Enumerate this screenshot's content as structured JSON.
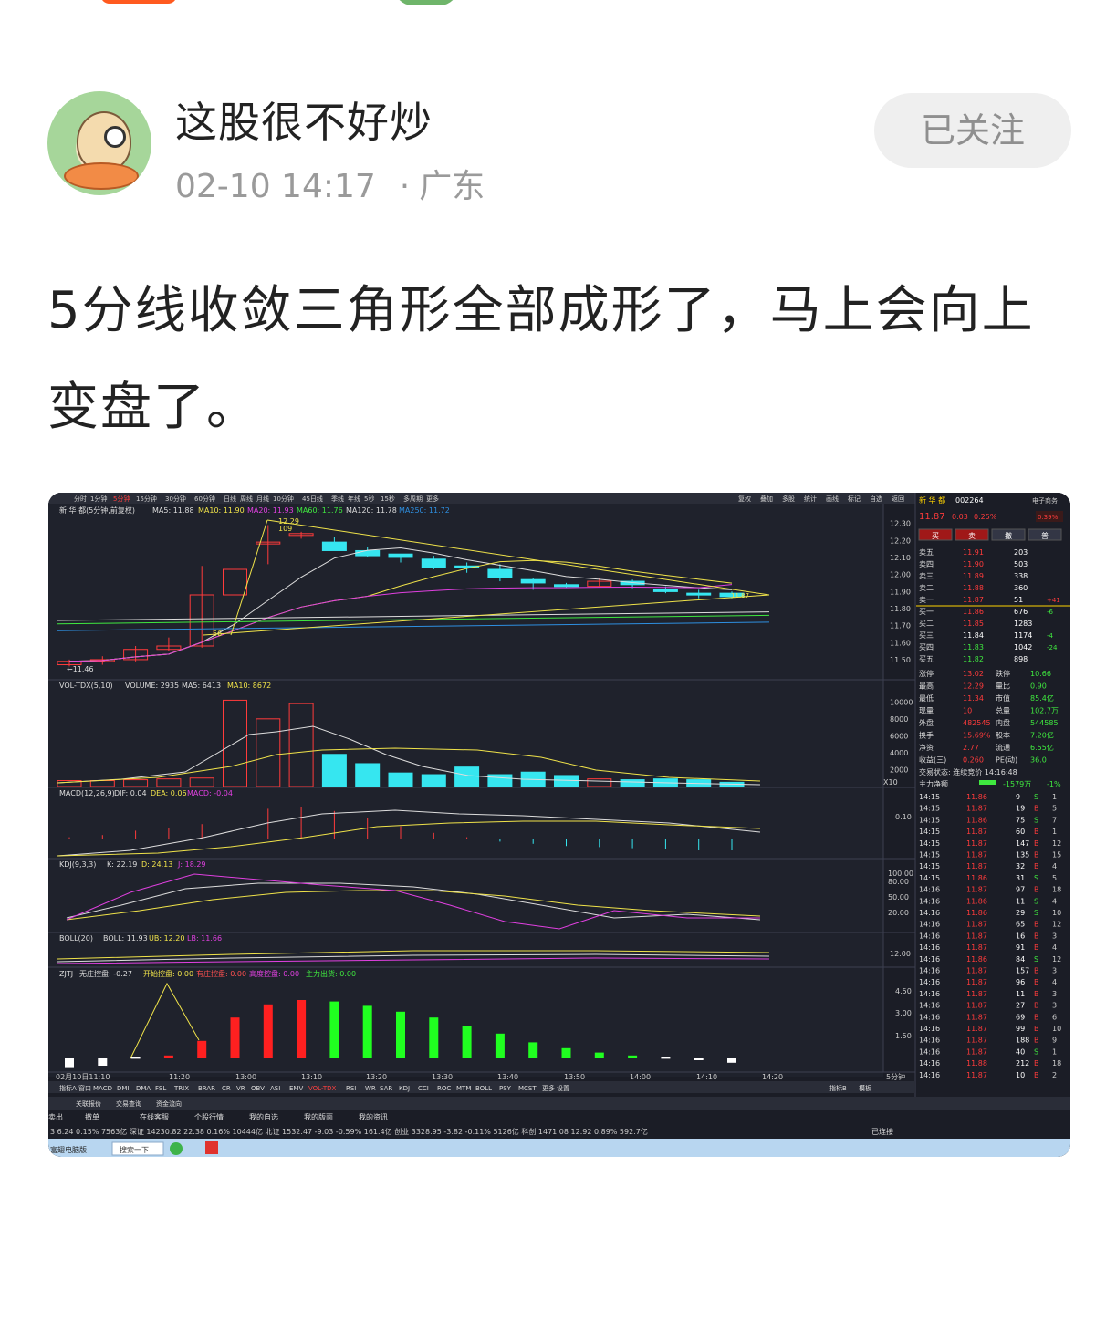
{
  "post": {
    "username": "这股很不好炒",
    "date": "02-10 14:17",
    "location": "广东",
    "follow_label": "已关注",
    "text": "5分线收敛三角形全部成形了，马上会向上变盘了。"
  },
  "screenshot": {
    "period_tabs": [
      "分时",
      "1分钟",
      "5分钟",
      "15分钟",
      "30分钟",
      "60分钟",
      "日线",
      "周线",
      "月线",
      "10分钟",
      "45日线",
      "季线",
      "年线",
      "5秒",
      "15秒",
      "多周期",
      "更多"
    ],
    "active_period": "5分钟",
    "right_tools": [
      "复权",
      "叠加",
      "多股",
      "统计",
      "画线",
      "标记",
      "自选",
      "返回"
    ],
    "header": {
      "name": "新 华 都(5分钟,前复权)",
      "ma5": "MA5: 11.88",
      "ma10": "MA10: 11.90",
      "ma20": "MA20: 11.93",
      "ma60": "MA60: 11.76",
      "ma120": "MA120: 11.78",
      "ma250": "MA250: 11.72"
    },
    "price_axis": [
      "12.30",
      "12.20",
      "12.10",
      "12.00",
      "11.90",
      "11.80",
      "11.70",
      "11.60",
      "11.50"
    ],
    "high_label": "12.29",
    "high_label2": "109",
    "low_label": "←11.46",
    "mark_56": "56",
    "last_label": "11.87",
    "vol": {
      "label": "VOL-TDX(5,10)",
      "volume": "VOLUME: 2935",
      "ma5": "MA5: 6413",
      "ma10": "MA10: 8672",
      "axis": [
        "10000",
        "8000",
        "6000",
        "4000",
        "2000"
      ],
      "unit": "X10"
    },
    "macd": {
      "label": "MACD(12,26,9)",
      "dif": "DIF: 0.04",
      "dea": "DEA: 0.06",
      "macd": "MACD: -0.04",
      "axis": [
        "0.10"
      ]
    },
    "kdj": {
      "label": "KDJ(9,3,3)",
      "k": "K: 22.19",
      "d": "D: 24.13",
      "j": "J: 18.29",
      "axis": [
        "100.00",
        "80.00",
        "50.00",
        "20.00"
      ]
    },
    "boll": {
      "label": "BOLL(20)",
      "boll": "BOLL: 11.93",
      "ub": "UB: 12.20",
      "lb": "LB: 11.66",
      "axis": [
        "12.00"
      ]
    },
    "zjtj": {
      "label": "ZJTJ",
      "wzk": "无庄控盘: -0.27",
      "kszk": "开始控盘: 0.00",
      "yzk": "有庄控盘: 0.00",
      "gdk": "高度控盘: 0.00",
      "zl": "主力出货: 0.00",
      "axis": [
        "4.50",
        "3.00",
        "1.50"
      ]
    },
    "time_axis": [
      "02月10日11:10",
      "11:20",
      "13:00",
      "13:10",
      "13:20",
      "13:30",
      "13:40",
      "13:50",
      "14:00",
      "14:10",
      "14:20"
    ],
    "time_axis_unit": "5分钟",
    "indicator_tabs": [
      "指标A",
      "窗口",
      "MACD",
      "DMI",
      "DMA",
      "FSL",
      "TRIX",
      "BRAR",
      "CR",
      "VR",
      "OBV",
      "ASI",
      "EMV",
      "VOL-TDX",
      "RSI",
      "WR",
      "SAR",
      "KDJ",
      "CCI",
      "ROC",
      "MTM",
      "BOLL",
      "PSY",
      "MCST",
      "更多",
      "设置"
    ],
    "indicator_right": [
      "指标B",
      "模板"
    ],
    "quote": {
      "name": "新 华 都",
      "code": "002264",
      "industry": "电子商务",
      "price": "11.87",
      "change": "0.03",
      "pct": "0.25%",
      "pct2": "0.39%",
      "buttons": [
        "买",
        "卖",
        "撤",
        "普"
      ],
      "asks": [
        {
          "label": "卖五",
          "price": "11.91",
          "vol": "203",
          "chg": ""
        },
        {
          "label": "卖四",
          "price": "11.90",
          "vol": "503",
          "chg": ""
        },
        {
          "label": "卖三",
          "price": "11.89",
          "vol": "338",
          "chg": ""
        },
        {
          "label": "卖二",
          "price": "11.88",
          "vol": "360",
          "chg": ""
        },
        {
          "label": "卖一",
          "price": "11.87",
          "vol": "51",
          "chg": "+41"
        }
      ],
      "bids": [
        {
          "label": "买一",
          "price": "11.86",
          "vol": "676",
          "chg": "-6"
        },
        {
          "label": "买二",
          "price": "11.85",
          "vol": "1283",
          "chg": ""
        },
        {
          "label": "买三",
          "price": "11.84",
          "vol": "1174",
          "chg": "-4"
        },
        {
          "label": "买四",
          "price": "11.83",
          "vol": "1042",
          "chg": "-24"
        },
        {
          "label": "买五",
          "price": "11.82",
          "vol": "898",
          "chg": ""
        }
      ],
      "stats": [
        [
          "涨停",
          "13.02",
          "跌停",
          "10.66"
        ],
        [
          "最高",
          "12.29",
          "量比",
          "0.90"
        ],
        [
          "最低",
          "11.34",
          "市值",
          "85.4亿"
        ],
        [
          "现量",
          "10",
          "总量",
          "102.7万"
        ],
        [
          "外盘",
          "482545",
          "内盘",
          "544585"
        ],
        [
          "换手",
          "15.69%",
          "股本",
          "7.20亿"
        ],
        [
          "净资",
          "2.77",
          "流通",
          "6.55亿"
        ],
        [
          "收益(三)",
          "0.260",
          "PE(动)",
          "36.0"
        ]
      ],
      "status": "交易状态: 连续竞价 14:16:48",
      "main_net_label": "主力净额",
      "main_net": "-1579万",
      "main_net_pct": "-1%",
      "ticks": [
        [
          "14:15",
          "11.86",
          "9",
          "S",
          "1"
        ],
        [
          "14:15",
          "11.87",
          "19",
          "B",
          "5"
        ],
        [
          "14:15",
          "11.86",
          "75",
          "S",
          "7"
        ],
        [
          "14:15",
          "11.87",
          "60",
          "B",
          "1"
        ],
        [
          "14:15",
          "11.87",
          "147",
          "B",
          "12"
        ],
        [
          "14:15",
          "11.87",
          "135",
          "B",
          "15"
        ],
        [
          "14:15",
          "11.87",
          "32",
          "B",
          "4"
        ],
        [
          "14:15",
          "11.86",
          "31",
          "S",
          "5"
        ],
        [
          "14:16",
          "11.87",
          "97",
          "B",
          "18"
        ],
        [
          "14:16",
          "11.86",
          "11",
          "S",
          "4"
        ],
        [
          "14:16",
          "11.86",
          "29",
          "S",
          "10"
        ],
        [
          "14:16",
          "11.87",
          "65",
          "B",
          "12"
        ],
        [
          "14:16",
          "11.87",
          "16",
          "B",
          "3"
        ],
        [
          "14:16",
          "11.87",
          "91",
          "B",
          "4"
        ],
        [
          "14:16",
          "11.86",
          "84",
          "S",
          "12"
        ],
        [
          "14:16",
          "11.87",
          "157",
          "B",
          "3"
        ],
        [
          "14:16",
          "11.87",
          "96",
          "B",
          "4"
        ],
        [
          "14:16",
          "11.87",
          "11",
          "B",
          "3"
        ],
        [
          "14:16",
          "11.87",
          "27",
          "B",
          "3"
        ],
        [
          "14:16",
          "11.87",
          "69",
          "B",
          "6"
        ],
        [
          "14:16",
          "11.87",
          "99",
          "B",
          "10"
        ],
        [
          "14:16",
          "11.87",
          "188",
          "B",
          "9"
        ],
        [
          "14:16",
          "11.87",
          "40",
          "S",
          "1"
        ],
        [
          "14:16",
          "11.88",
          "212",
          "B",
          "18"
        ],
        [
          "14:16",
          "11.87",
          "10",
          "B",
          "2"
        ]
      ],
      "bottom_tabs": [
        "笔",
        "价",
        "细",
        "势",
        "联",
        "值",
        "主",
        "逆",
        "筹"
      ],
      "f10": "图文F10",
      "sidebar": "侧边栏"
    },
    "bottom_bar": [
      "关联报价",
      "交易查询",
      "资金流向"
    ],
    "toolbar": [
      "撤单",
      "在线客服",
      "个股行情",
      "我的自选",
      "我的版面",
      "我的资讯"
    ],
    "toolbar_left": "卖出",
    "index_bar": "3  6.24  0.15%  7563亿   深证 14230.82  22.38  0.16%  10444亿   北证 1532.47  -9.03  -0.59%  161.4亿   创业 3328.95  -3.82  -0.11%  5126亿   科创 1471.08  12.92  0.89%  592.7亿",
    "connected": "已连接",
    "taskbar_left": "富翅电脑版",
    "taskbar_search": "搜索一下"
  },
  "chart_data": {
    "type": "candlestick",
    "title": "新 华 都(5分钟,前复权)",
    "categories": [
      "11:10",
      "11:15",
      "11:20",
      "11:25",
      "11:30",
      "13:05",
      "13:10",
      "13:15",
      "13:20",
      "13:25",
      "13:30",
      "13:35",
      "13:40",
      "13:45",
      "13:50",
      "13:55",
      "14:00",
      "14:05",
      "14:10",
      "14:15",
      "14:20"
    ],
    "open": [
      11.47,
      11.49,
      11.5,
      11.56,
      11.58,
      11.88,
      12.18,
      12.24,
      12.19,
      12.14,
      12.12,
      12.09,
      12.05,
      12.03,
      11.97,
      11.94,
      11.93,
      11.96,
      11.91,
      11.89,
      11.89
    ],
    "close": [
      11.49,
      11.5,
      11.56,
      11.58,
      11.88,
      12.03,
      12.19,
      12.24,
      12.14,
      12.11,
      12.1,
      12.04,
      12.04,
      11.98,
      11.95,
      11.93,
      11.96,
      11.94,
      11.9,
      11.88,
      11.87
    ],
    "high": [
      11.5,
      11.52,
      11.58,
      11.63,
      12.05,
      12.1,
      12.29,
      12.25,
      12.22,
      12.16,
      12.12,
      12.11,
      12.07,
      12.06,
      11.98,
      11.95,
      11.98,
      11.97,
      11.93,
      11.91,
      11.9
    ],
    "low": [
      11.46,
      11.47,
      11.49,
      11.55,
      11.57,
      11.8,
      12.06,
      12.21,
      12.14,
      12.1,
      12.07,
      12.03,
      12.01,
      11.96,
      11.91,
      11.92,
      11.93,
      11.92,
      11.89,
      11.86,
      11.86
    ],
    "volume": [
      700,
      700,
      800,
      900,
      1000,
      10200,
      8000,
      9800,
      3800,
      2700,
      1600,
      1400,
      2300,
      1400,
      1700,
      1300,
      900,
      800,
      900,
      800,
      500
    ],
    "ylim": [
      11.43,
      12.33
    ]
  }
}
